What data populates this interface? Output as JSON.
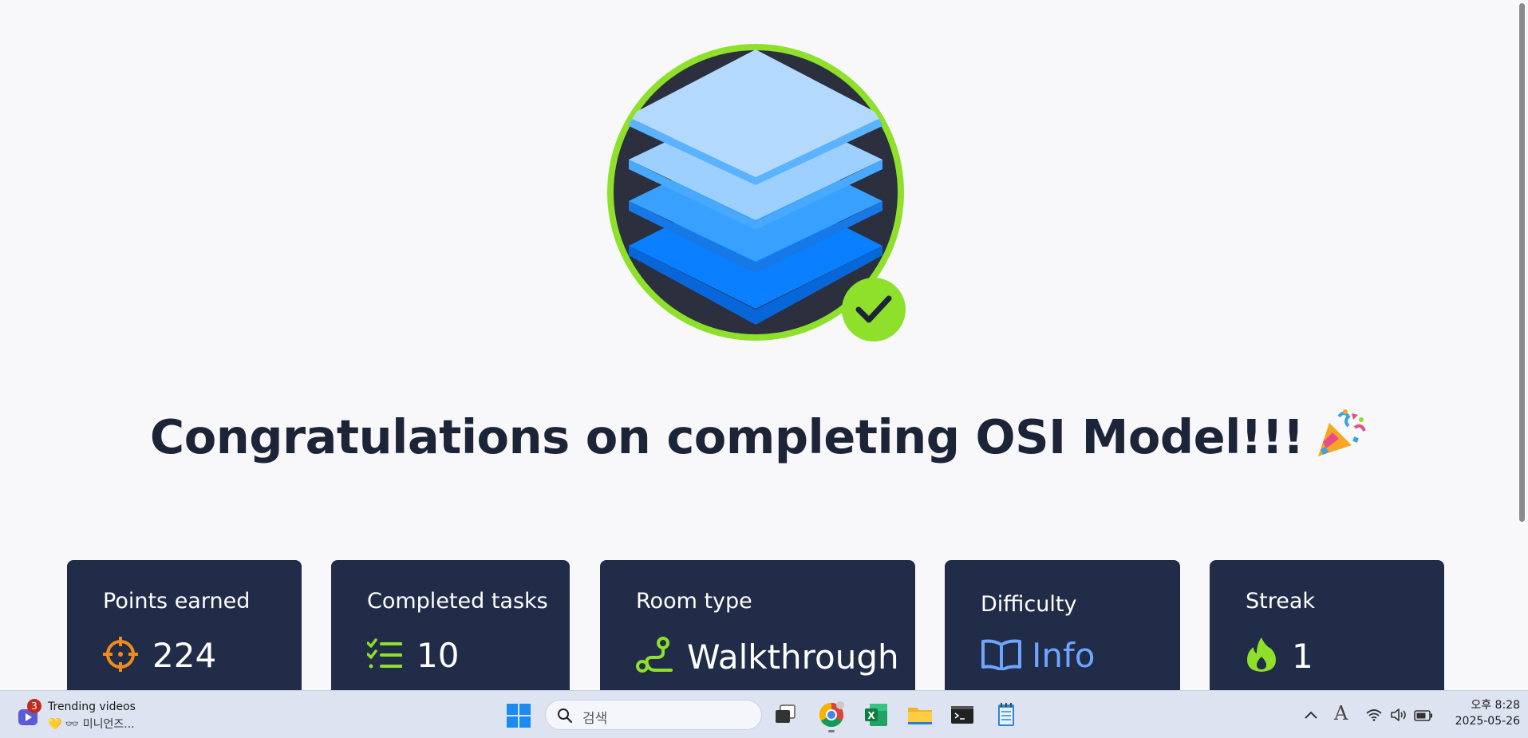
{
  "heading": {
    "text": "Congratulations on completing OSI Model!!!",
    "emoji_icon": "party-popper-icon"
  },
  "badge": {
    "icon": "stacked-layers-icon",
    "check_icon": "checkmark-icon",
    "colors": {
      "ring": "#8ee02a",
      "background": "#2b2f3e",
      "layer_light": "#b3d9ff",
      "layer_mid": "#60b0ff",
      "layer_dark": "#0a7fff"
    }
  },
  "stats": [
    {
      "label": "Points earned",
      "value": "224",
      "icon": "target-icon",
      "icon_color": "#f28c18"
    },
    {
      "label": "Completed tasks",
      "value": "10",
      "icon": "checklist-icon",
      "icon_color": "#8ee02a"
    },
    {
      "label": "Room type",
      "value": "Walkthrough",
      "icon": "route-icon",
      "icon_color": "#8ee02a"
    },
    {
      "label": "Difficulty",
      "value": "Info",
      "icon": "book-icon",
      "icon_color": "#6ea6ff"
    },
    {
      "label": "Streak",
      "value": "1",
      "icon": "flame-icon",
      "icon_color": "#8ee02a"
    }
  ],
  "taskbar": {
    "widget": {
      "badge_count": "3",
      "title": "Trending videos",
      "subtitle": "💛 👓 미니언즈..."
    },
    "search": {
      "placeholder": "검색"
    },
    "apps": [
      "task-view-icon",
      "chrome-icon",
      "excel-icon",
      "file-explorer-icon",
      "terminal-icon",
      "notepad-icon"
    ],
    "tray": {
      "ime_letter": "A",
      "icons": [
        "chevron-up-icon",
        "wifi-icon",
        "speaker-icon",
        "battery-icon"
      ]
    },
    "clock": {
      "time": "오후 8:28",
      "date": "2025-05-26"
    }
  }
}
